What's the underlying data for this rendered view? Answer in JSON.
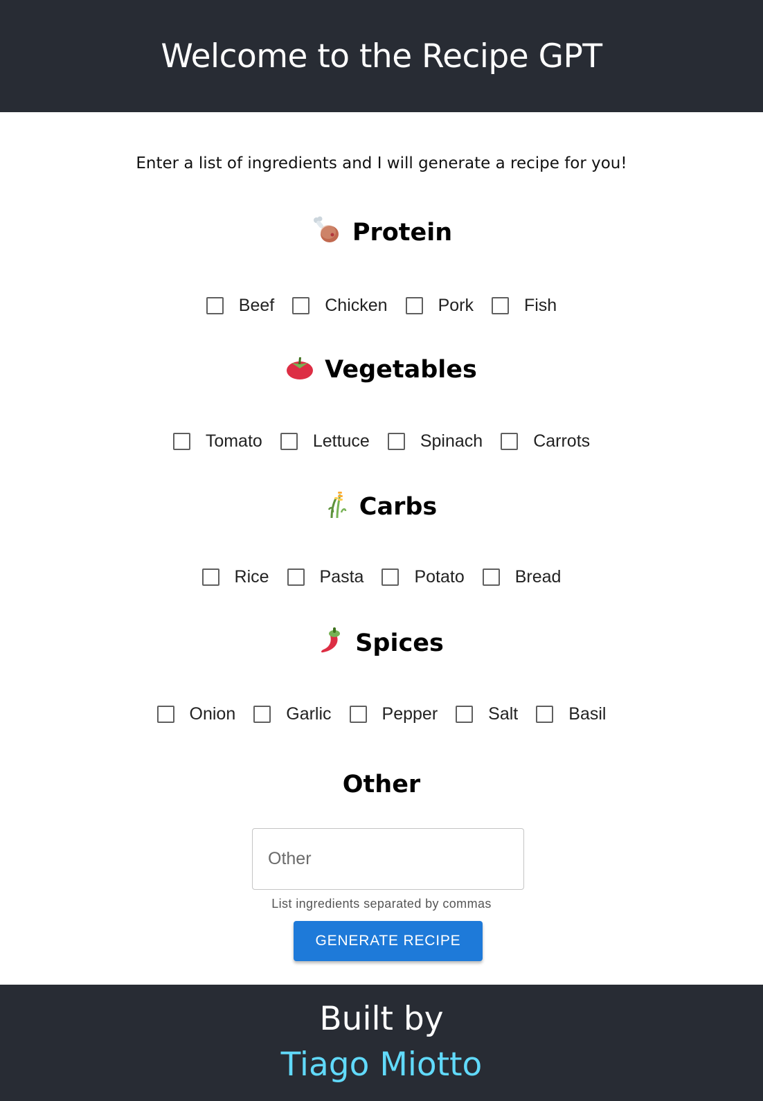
{
  "header": {
    "title": "Welcome to the Recipe GPT"
  },
  "intro": "Enter a list of ingredients and I will generate a recipe for you!",
  "sections": {
    "protein": {
      "title": "Protein",
      "icon": "drumstick-icon",
      "options": [
        "Beef",
        "Chicken",
        "Pork",
        "Fish"
      ]
    },
    "vegetables": {
      "title": "Vegetables",
      "icon": "tomato-icon",
      "options": [
        "Tomato",
        "Lettuce",
        "Spinach",
        "Carrots"
      ]
    },
    "carbs": {
      "title": "Carbs",
      "icon": "wheat-icon",
      "options": [
        "Rice",
        "Pasta",
        "Potato",
        "Bread"
      ]
    },
    "spices": {
      "title": "Spices",
      "icon": "chili-pepper-icon",
      "options": [
        "Onion",
        "Garlic",
        "Pepper",
        "Salt",
        "Basil"
      ]
    },
    "other": {
      "title": "Other"
    }
  },
  "other_input": {
    "placeholder": "Other",
    "value": "",
    "helper": "List ingredients separated by commas"
  },
  "generate_button": "GENERATE RECIPE",
  "footer": {
    "built_by": "Built by",
    "author": "Tiago Miotto"
  },
  "colors": {
    "header_bg": "#282c34",
    "button": "#1e7ad9",
    "author_link": "#61dafb"
  }
}
